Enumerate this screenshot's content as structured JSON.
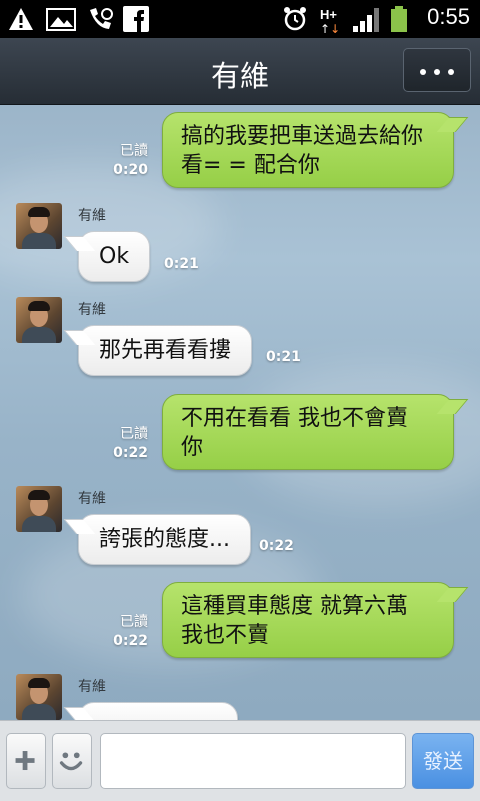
{
  "status_bar": {
    "time": "0:55",
    "icons": [
      "warning-icon",
      "gallery-icon",
      "phone-sync-icon",
      "facebook-icon",
      "alarm-icon",
      "hspa-data-icon",
      "signal-icon",
      "battery-icon"
    ],
    "network_label": "H+"
  },
  "header": {
    "title": "有維",
    "menu_icon": "more-dots-icon"
  },
  "chat": {
    "messages": [
      {
        "direction": "out",
        "text_lines": [
          "搞的我要把車送過去給你",
          "看= = 配合你"
        ],
        "read_label": "已讀",
        "time": "0:20"
      },
      {
        "direction": "in",
        "sender": "有維",
        "text": "Ok",
        "time": "0:21"
      },
      {
        "direction": "in",
        "sender": "有維",
        "text": "那先再看看摟",
        "time": "0:21"
      },
      {
        "direction": "out",
        "text_lines": [
          "不用在看看 我也不會賣",
          "你"
        ],
        "read_label": "已讀",
        "time": "0:22"
      },
      {
        "direction": "in",
        "sender": "有維",
        "text": "誇張的態度...",
        "time": "0:22"
      },
      {
        "direction": "out",
        "text_lines": [
          "這種買車態度 就算六萬",
          "我也不賣"
        ],
        "read_label": "已讀",
        "time": "0:22"
      },
      {
        "direction": "in",
        "sender": "有維",
        "text": "",
        "time": ""
      }
    ]
  },
  "input_bar": {
    "plus_icon": "plus-icon",
    "emoji_icon": "smiley-icon",
    "message_value": "",
    "send_label": "發送"
  },
  "colors": {
    "out_bubble": "#a6d95a",
    "in_bubble": "#ffffff",
    "header_bg": "#2f363f",
    "chat_bg": "#9cb5c9",
    "send_button": "#4a90e2"
  }
}
